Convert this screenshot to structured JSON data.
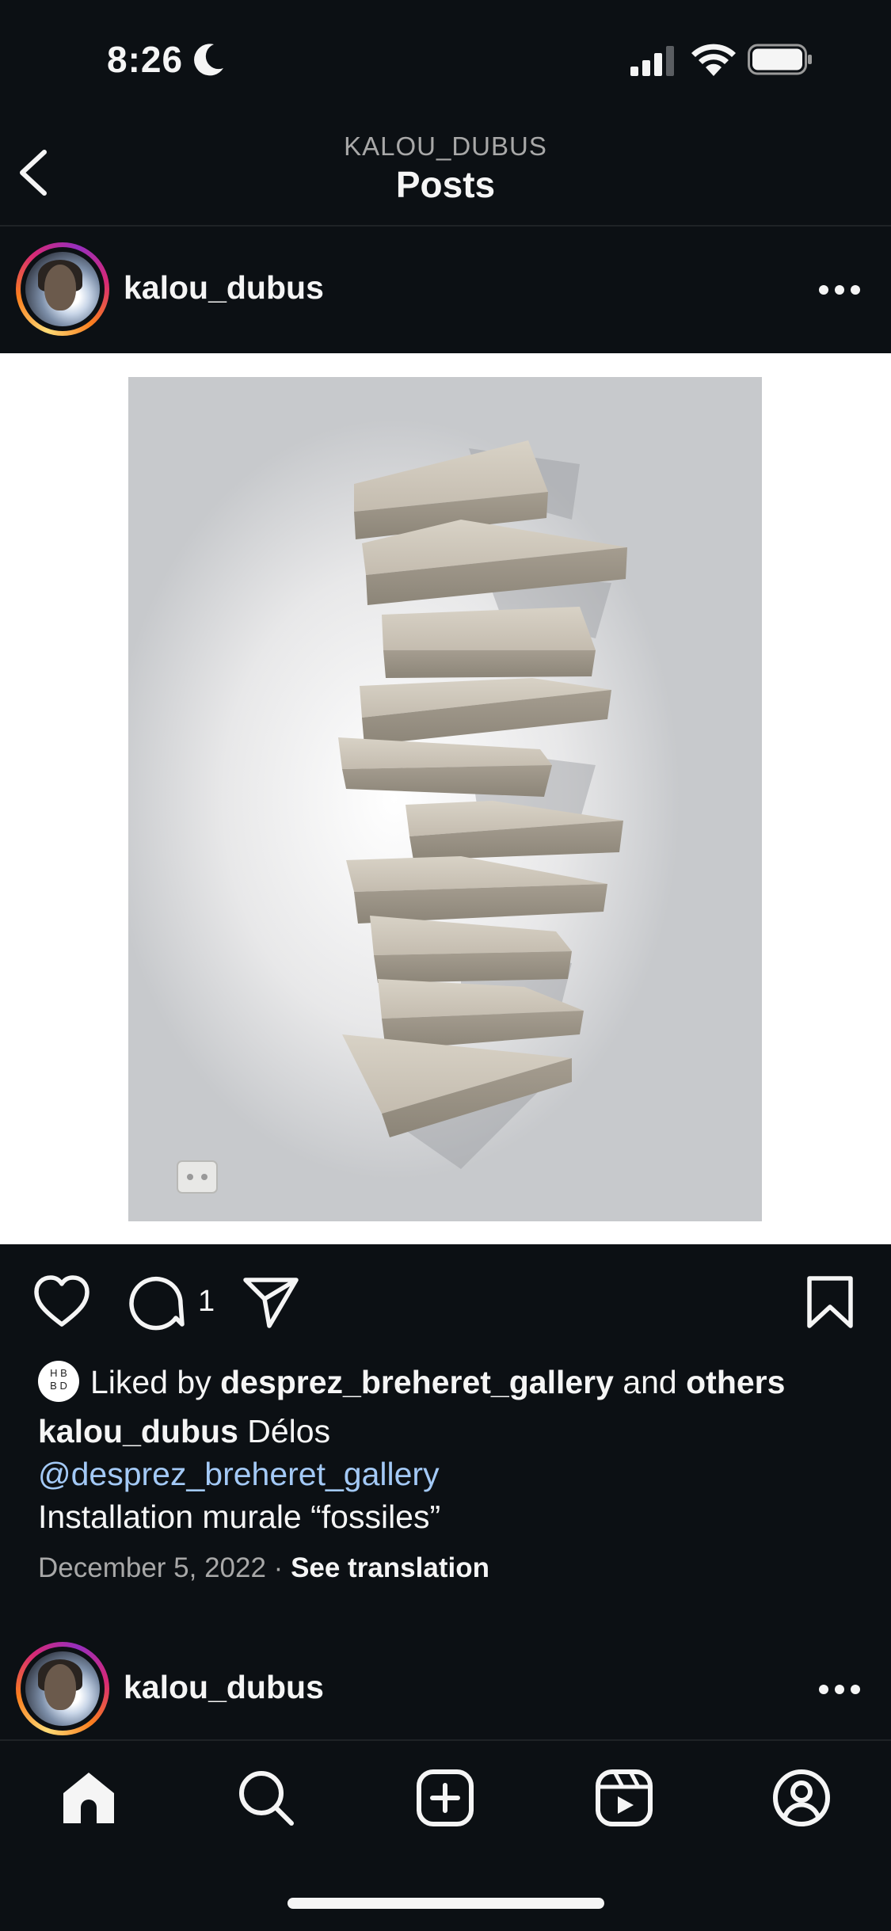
{
  "status_bar": {
    "time": "8:26"
  },
  "header": {
    "subtitle": "KALOU_DUBUS",
    "title": "Posts"
  },
  "post": {
    "username": "kalou_dubus",
    "comment_count": "1",
    "liked_by_prefix": "Liked by ",
    "liked_by_user": "desprez_breheret_gallery",
    "liked_by_and": " and ",
    "liked_by_others": "others",
    "liked_avatar_text": "H B B D",
    "caption_user": "kalou_dubus",
    "caption_text": " Délos",
    "caption_mention": "@desprez_breheret_gallery",
    "caption_line3": "Installation murale “fossiles”",
    "date": "December 5, 2022",
    "separator": " · ",
    "see_translation": "See translation"
  },
  "next_post": {
    "username": "kalou_dubus"
  },
  "tab_bar": {
    "items": [
      "home-icon",
      "search-icon",
      "create-icon",
      "reels-icon",
      "profile-icon"
    ],
    "active": "home"
  },
  "colors": {
    "background": "#0c1014",
    "mention": "#a3c9f6",
    "muted": "#a8a8a8"
  }
}
